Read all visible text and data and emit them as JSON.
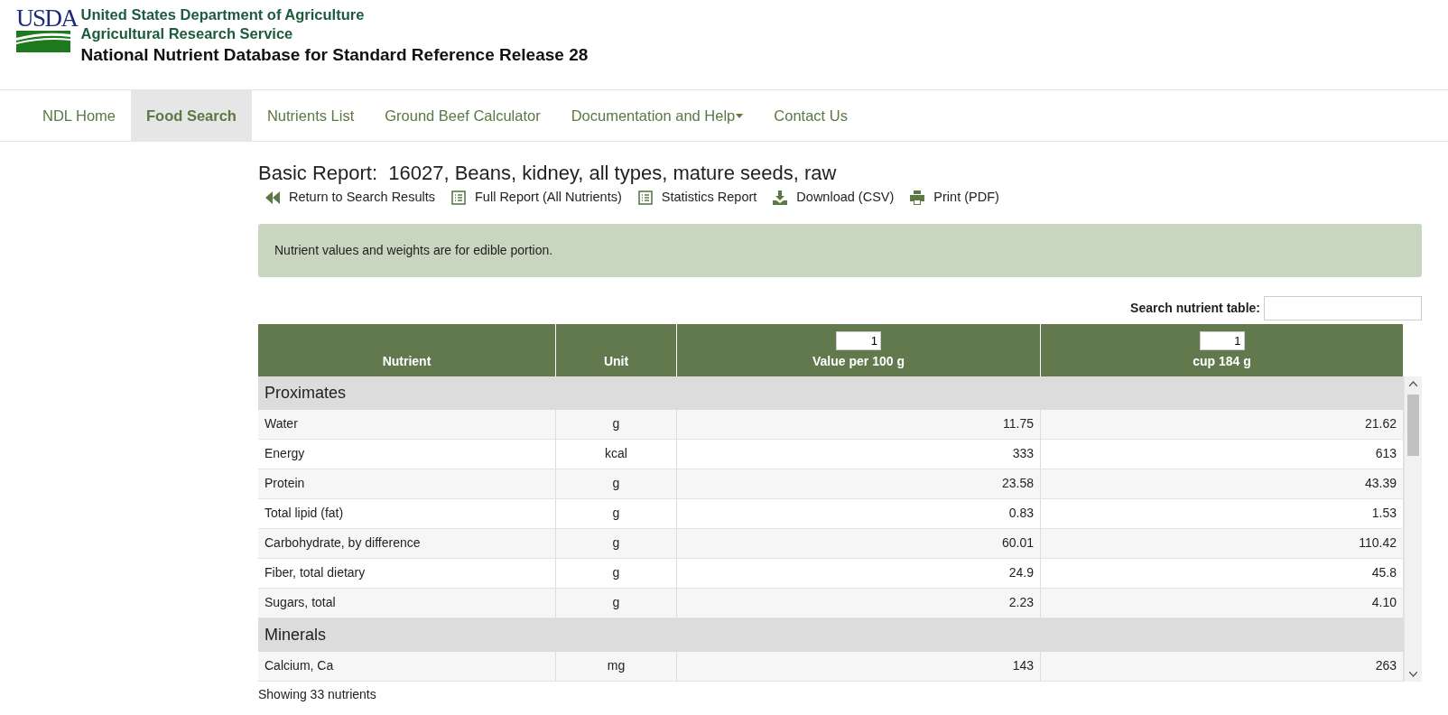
{
  "header": {
    "logo_text": "USDA",
    "agency": "United States Department of Agriculture",
    "service": "Agricultural Research Service",
    "database": "National Nutrient Database for Standard Reference Release 28"
  },
  "nav": [
    {
      "label": "NDL Home",
      "selected": false,
      "dropdown": false
    },
    {
      "label": "Food Search",
      "selected": true,
      "dropdown": false
    },
    {
      "label": "Nutrients List",
      "selected": false,
      "dropdown": false
    },
    {
      "label": "Ground Beef Calculator",
      "selected": false,
      "dropdown": false
    },
    {
      "label": "Documentation and Help",
      "selected": false,
      "dropdown": true
    },
    {
      "label": "Contact Us",
      "selected": false,
      "dropdown": false
    }
  ],
  "report": {
    "title": "Basic Report:  16027, Beans, kidney, all types, mature seeds, raw",
    "actions": [
      {
        "label": "Return to Search Results",
        "kind": "back"
      },
      {
        "label": "Full Report (All Nutrients)",
        "kind": "list"
      },
      {
        "label": "Statistics Report",
        "kind": "list"
      },
      {
        "label": "Download (CSV)",
        "kind": "download"
      },
      {
        "label": "Print (PDF)",
        "kind": "print"
      }
    ]
  },
  "notice": "Nutrient values and weights are for edible portion.",
  "search": {
    "label": "Search nutrient table:"
  },
  "table": {
    "columns": [
      {
        "label": "Nutrient"
      },
      {
        "label": "Unit"
      },
      {
        "label": "Value per 100 g",
        "quantity": "1"
      },
      {
        "label": "cup 184 g",
        "quantity": "1"
      }
    ],
    "groups": [
      {
        "name": "Proximates",
        "rows": [
          {
            "nutrient": "Water",
            "unit": "g",
            "value": "11.75",
            "portion": "21.62"
          },
          {
            "nutrient": "Energy",
            "unit": "kcal",
            "value": "333",
            "portion": "613"
          },
          {
            "nutrient": "Protein",
            "unit": "g",
            "value": "23.58",
            "portion": "43.39"
          },
          {
            "nutrient": "Total lipid (fat)",
            "unit": "g",
            "value": "0.83",
            "portion": "1.53"
          },
          {
            "nutrient": "Carbohydrate, by difference",
            "unit": "g",
            "value": "60.01",
            "portion": "110.42"
          },
          {
            "nutrient": "Fiber, total dietary",
            "unit": "g",
            "value": "24.9",
            "portion": "45.8"
          },
          {
            "nutrient": "Sugars, total",
            "unit": "g",
            "value": "2.23",
            "portion": "4.10"
          }
        ]
      },
      {
        "name": "Minerals",
        "rows": [
          {
            "nutrient": "Calcium, Ca",
            "unit": "mg",
            "value": "143",
            "portion": "263"
          }
        ]
      }
    ]
  },
  "footer": "Showing 33 nutrients"
}
